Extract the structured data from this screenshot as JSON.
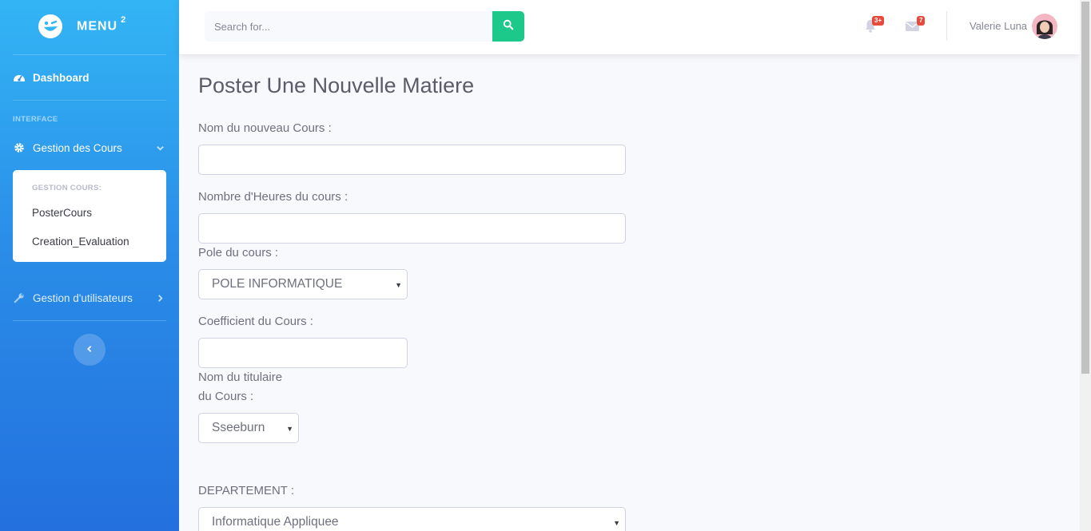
{
  "sidebar": {
    "brand": {
      "text": "MENU",
      "sup": "2"
    },
    "dashboard": "Dashboard",
    "heading": "INTERFACE",
    "gestion_cours": "Gestion des Cours",
    "collapse": {
      "header": "GESTION COURS:",
      "items": [
        "PosterCours",
        "Creation_Evaluation"
      ]
    },
    "gestion_utilisateurs": "Gestion d'utilisateurs"
  },
  "topbar": {
    "search_placeholder": "Search for...",
    "alerts_badge": "3+",
    "messages_badge": "7",
    "username": "Valerie Luna"
  },
  "form": {
    "title": "Poster Une Nouvelle Matiere",
    "nom_label": "Nom du nouveau Cours :",
    "heures_label": "Nombre d'Heures du cours :",
    "pole_label": "Pole du cours :",
    "pole_value": "POLE INFORMATIQUE",
    "coef_label": "Coefficient du Cours :",
    "titulaire_label_1": "Nom du titulaire",
    "titulaire_label_2": "du Cours :",
    "titulaire_value": "Sseeburn",
    "dept_label": "DEPARTEMENT :",
    "dept_value": "Informatique Appliquee"
  },
  "colors": {
    "sidebar_top": "#33b5f5",
    "sidebar_bottom": "#2370de",
    "search_button": "#1cc88a",
    "badge": "#e74a3b"
  },
  "icons": [
    "logo-icon",
    "dashboard-icon",
    "gear-icon",
    "chevron-down-icon",
    "wrench-icon",
    "chevron-right-icon",
    "chevron-left-icon",
    "search-icon",
    "bell-icon",
    "envelope-icon"
  ]
}
